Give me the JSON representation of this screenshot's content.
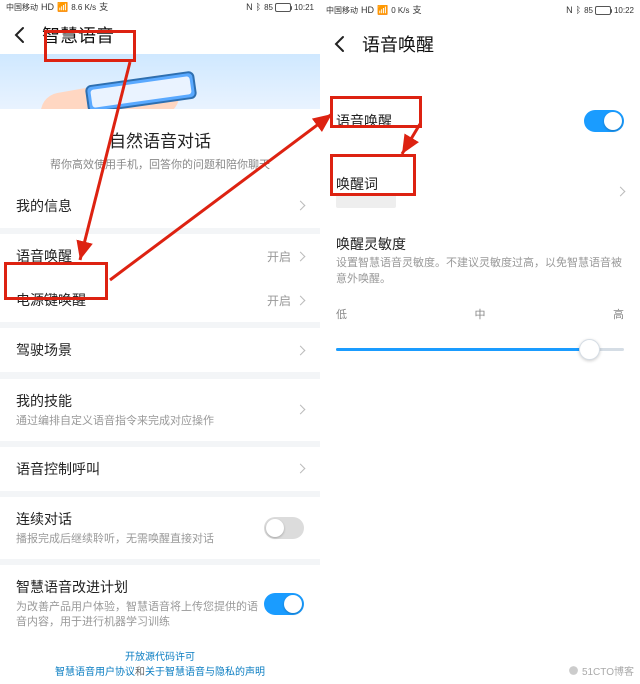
{
  "status_bar": {
    "carrier": "中国移动",
    "net_badge": "HD",
    "sig": "5G",
    "speed_left": "8.6 K/s",
    "speed_right": "0 K/s",
    "icons": [
      "N",
      "⋮",
      "ᛒ"
    ],
    "battery_pct": "85",
    "time_left": "10:21",
    "time_right": "10:22"
  },
  "left": {
    "title": "智慧语音",
    "hero_title": "自然语音对话",
    "hero_desc": "帮你高效使用手机，回答你的问题和陪你聊天",
    "items": {
      "my_info": "我的信息",
      "voice_wake": "语音唤醒",
      "voice_wake_val": "开启",
      "power_wake": "电源键唤醒",
      "power_wake_val": "开启",
      "drive": "驾驶场景",
      "skills": "我的技能",
      "skills_sub": "通过编排自定义语音指令来完成对应操作",
      "call": "语音控制呼叫",
      "cont": "连续对话",
      "cont_sub": "播报完成后继续聆听，无需唤醒直接对话",
      "improve": "智慧语音改进计划",
      "improve_sub": "为改善产品用户体验，智慧语音将上传您提供的语音内容，用于进行机器学习训练"
    },
    "links": {
      "l1": "开放源代码许可",
      "l2a": "智慧语音用户协议",
      "l2mid": "和",
      "l2b": "关于智慧语音与隐私的声明"
    }
  },
  "right": {
    "title": "语音唤醒",
    "items": {
      "voice_wake": "语音唤醒",
      "wake_word": "唤醒词",
      "sens": "唤醒灵敏度",
      "sens_desc": "设置智慧语音灵敏度。不建议灵敏度过高，以免智慧语音被意外唤醒。",
      "low": "低",
      "mid": "中",
      "high": "高"
    },
    "slider_pct": 88
  },
  "watermark": "51CTO博客"
}
